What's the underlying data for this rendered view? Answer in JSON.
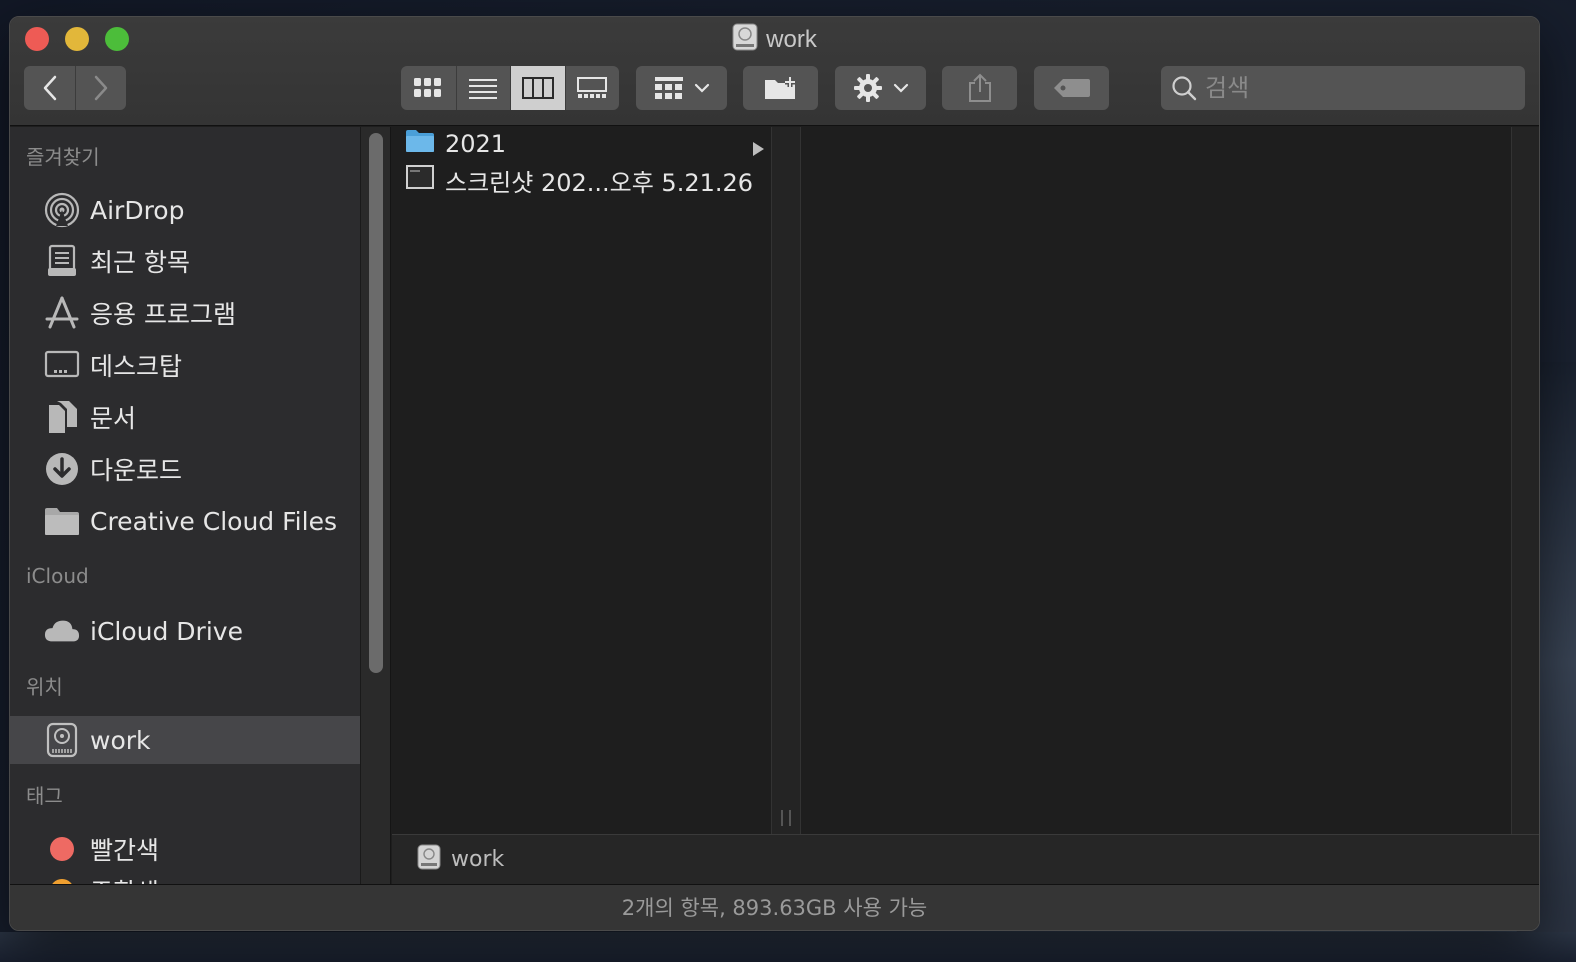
{
  "window": {
    "title": "work"
  },
  "toolbar": {
    "back": "chevron-left-icon",
    "forward": "chevron-right-icon",
    "search_placeholder": "검색"
  },
  "sidebar": {
    "favorites_header": "즐겨찾기",
    "favorites": [
      {
        "label": "AirDrop",
        "icon": "airdrop-icon"
      },
      {
        "label": "최근 항목",
        "icon": "recents-icon"
      },
      {
        "label": "응용 프로그램",
        "icon": "applications-icon"
      },
      {
        "label": "데스크탑",
        "icon": "desktop-icon"
      },
      {
        "label": "문서",
        "icon": "documents-icon"
      },
      {
        "label": "다운로드",
        "icon": "downloads-icon"
      },
      {
        "label": "Creative Cloud Files",
        "icon": "folder-icon"
      }
    ],
    "icloud_header": "iCloud",
    "icloud": [
      {
        "label": "iCloud Drive",
        "icon": "cloud-icon"
      }
    ],
    "locations_header": "위치",
    "locations": [
      {
        "label": "work",
        "icon": "disk-icon",
        "selected": true
      }
    ],
    "tags_header": "태그",
    "tags": [
      {
        "label": "빨간색",
        "color": "#ee6a63"
      },
      {
        "label": "주황색",
        "color": "#f0a030"
      }
    ]
  },
  "column1": {
    "items": [
      {
        "name": "2021",
        "kind": "folder",
        "has_children": true
      },
      {
        "name": "스크린샷 202...오후 5.21.26",
        "kind": "image"
      }
    ]
  },
  "pathbar": {
    "label": "work"
  },
  "status": {
    "text": "2개의 항목, 893.63GB 사용 가능"
  }
}
